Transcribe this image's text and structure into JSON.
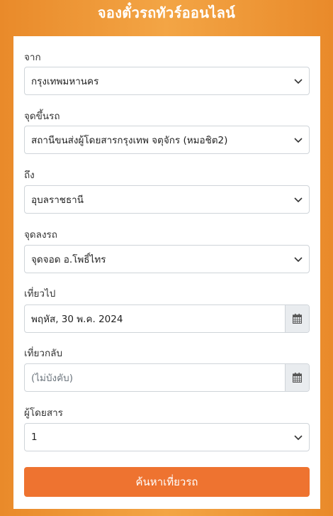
{
  "header": {
    "title": "จองตั๋วรถทัวร์ออนไลน์"
  },
  "form": {
    "from": {
      "label": "จาก",
      "value": "กรุงเทพมหานคร"
    },
    "pickup": {
      "label": "จุดขึ้นรถ",
      "value": "สถานีขนส่งผู้โดยสารกรุงเทพ จตุจักร (หมอชิต2)"
    },
    "to": {
      "label": "ถึง",
      "value": "อุบลราชธานี"
    },
    "dropoff": {
      "label": "จุดลงรถ",
      "value": "จุดจอด อ.โพธิ์ไทร"
    },
    "depart": {
      "label": "เที่ยวไป",
      "value": "พฤหัส, 30 พ.ค. 2024"
    },
    "return": {
      "label": "เที่ยวกลับ",
      "placeholder": "(ไม่บังคับ)"
    },
    "passengers": {
      "label": "ผู้โดยสาร",
      "value": "1"
    },
    "search_button": "ค้นหาเที่ยวรถ"
  },
  "icons": {
    "select": "chevron-down-icon",
    "date": "calendar-icon"
  },
  "colors": {
    "background": "#f3a545",
    "button": "#ee7330",
    "addon": "#e9ecef"
  }
}
